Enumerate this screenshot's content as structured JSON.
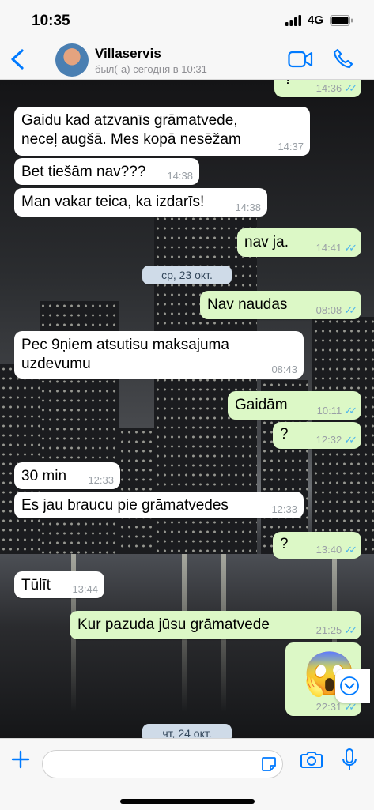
{
  "status_bar": {
    "time": "10:35",
    "network": "4G"
  },
  "header": {
    "contact_name": "Villaservis",
    "last_seen": "был(-а) сегодня в 10:31",
    "colors": {
      "accent": "#007aff"
    }
  },
  "chat": {
    "messages": [
      {
        "dir": "out",
        "text": "?",
        "time": "14:36",
        "ticks": "✓✓"
      },
      {
        "dir": "in",
        "text": "Gaidu kad atzvanīs grāmatvede, neceļ augšā. Mes kopā nesēžam",
        "time": "14:37"
      },
      {
        "dir": "in",
        "text": "Bet tiešām nav???",
        "time": "14:38"
      },
      {
        "dir": "in",
        "text": "Man vakar teica, ka izdarīs!",
        "time": "14:38"
      },
      {
        "dir": "out",
        "text": "nav ja.",
        "time": "14:41",
        "ticks": "✓✓"
      },
      {
        "dir": "out",
        "text": "Nav naudas",
        "time": "08:08",
        "ticks": "✓✓"
      },
      {
        "dir": "in",
        "text": "Pec 9ņiem atsutisu maksajuma uzdevumu",
        "time": "08:43"
      },
      {
        "dir": "out",
        "text": "Gaidām",
        "time": "10:11",
        "ticks": "✓✓"
      },
      {
        "dir": "out",
        "text": "?",
        "time": "12:32",
        "ticks": "✓✓"
      },
      {
        "dir": "in",
        "text": "30 min",
        "time": "12:33"
      },
      {
        "dir": "in",
        "text": "Es jau braucu pie grāmatvedes",
        "time": "12:33"
      },
      {
        "dir": "out",
        "text": "?",
        "time": "13:40",
        "ticks": "✓✓"
      },
      {
        "dir": "in",
        "text": "Tūlīt",
        "time": "13:44"
      },
      {
        "dir": "out",
        "text": "Kur pazuda jūsu grāmatvede",
        "time": "21:25",
        "ticks": "✓✓"
      },
      {
        "dir": "out",
        "text": "😱",
        "time": "22:31",
        "ticks": "✓✓"
      }
    ],
    "dates": [
      "ср, 23 окт.",
      "чт, 24 окт."
    ],
    "colors": {
      "outgoing": "#dcf8c6",
      "incoming": "#ffffff",
      "read_ticks": "#4fb6ec"
    }
  },
  "icons": [
    "back-chevron-icon",
    "video-call-icon",
    "phone-icon",
    "chevron-down-icon",
    "plus-icon",
    "sticker-icon",
    "camera-icon",
    "microphone-icon"
  ]
}
